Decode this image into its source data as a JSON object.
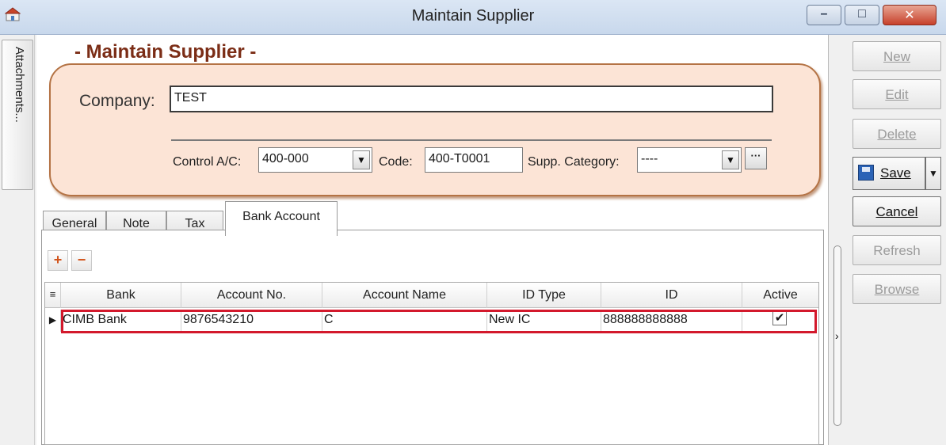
{
  "window": {
    "title": "Maintain Supplier",
    "min_glyph": "–",
    "max_glyph": "□",
    "close_glyph": "✕"
  },
  "sidebar": {
    "attachments_label": "Attachments..."
  },
  "form": {
    "heading": "- Maintain Supplier -",
    "company_label": "Company:",
    "company_value": "TEST",
    "control_ac_label": "Control A/C:",
    "control_ac_value": "400-000",
    "code_label": "Code:",
    "code_value": "400-T0001",
    "supp_category_label": "Supp. Category:",
    "supp_category_value": "----",
    "ellipsis": "···",
    "dropdown_arrow": "▼"
  },
  "tabs": [
    {
      "label": "General"
    },
    {
      "label": "Note"
    },
    {
      "label": "Tax"
    },
    {
      "label": "Bank Account"
    }
  ],
  "bank_account": {
    "add_glyph": "+",
    "remove_glyph": "−",
    "columns": [
      "Bank",
      "Account No.",
      "Account Name",
      "ID Type",
      "ID",
      "Active"
    ],
    "rows": [
      {
        "bank": "CIMB Bank",
        "account_no": "9876543210",
        "account_name": "C",
        "id_type": "New IC",
        "id": "888888888888",
        "active": "✔"
      }
    ],
    "row_indicator": "▶",
    "header_icon": "≡"
  },
  "actions": {
    "new": "New",
    "edit": "Edit",
    "delete": "Delete",
    "save": "Save",
    "cancel": "Cancel",
    "refresh": "Refresh",
    "browse": "Browse"
  },
  "colors": {
    "heading": "#7b2d16",
    "panel_fill": "#fce4d6",
    "panel_border": "#b47345",
    "highlight": "#d3192c"
  }
}
